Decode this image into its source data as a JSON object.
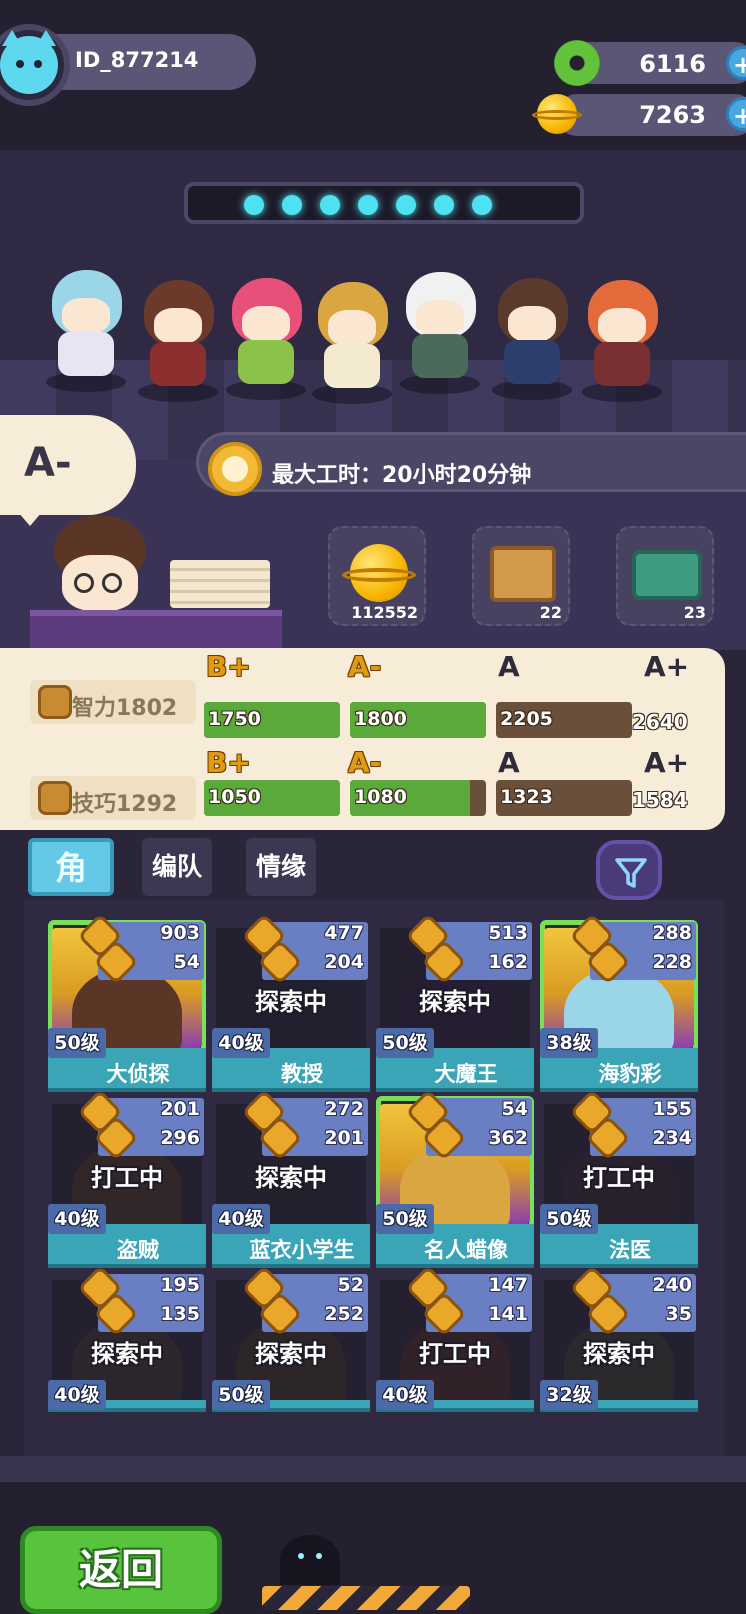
{
  "player": {
    "id": "ID_877214"
  },
  "currencies": {
    "donut": "6116",
    "gold": "7263",
    "plus_label": "+"
  },
  "scene": {
    "grade_bubble": "A-",
    "worktime_label": "最大工时：20小时20分钟",
    "resources": [
      {
        "icon": "gold-planet-icon",
        "count": "112552"
      },
      {
        "icon": "crate-icon",
        "count": "22"
      },
      {
        "icon": "bone-kit-icon",
        "count": "23"
      }
    ]
  },
  "stats": {
    "rows": [
      {
        "name": "智力1802",
        "grades": [
          "B+",
          "A-",
          "A",
          "A+"
        ],
        "thresholds": [
          "1750",
          "1800",
          "2205",
          "2640"
        ],
        "fills": [
          1,
          1,
          0,
          0
        ]
      },
      {
        "name": "技巧1292",
        "grades": [
          "B+",
          "A-",
          "A",
          "A+"
        ],
        "thresholds": [
          "1050",
          "1080",
          "1323",
          "1584"
        ],
        "fills": [
          1,
          0.88,
          0,
          0
        ]
      }
    ]
  },
  "tabs": {
    "characters": "角色",
    "team": "编队",
    "bond": "情缘"
  },
  "cards": [
    {
      "v1": "903",
      "v2": "54",
      "status": "",
      "level": "50级",
      "name": "大侦探"
    },
    {
      "v1": "477",
      "v2": "204",
      "status": "探索中",
      "level": "40级",
      "name": "教授"
    },
    {
      "v1": "513",
      "v2": "162",
      "status": "探索中",
      "level": "50级",
      "name": "大魔王"
    },
    {
      "v1": "288",
      "v2": "228",
      "status": "",
      "level": "38级",
      "name": "海豹彩"
    },
    {
      "v1": "201",
      "v2": "296",
      "status": "打工中",
      "level": "40级",
      "name": "盗贼"
    },
    {
      "v1": "272",
      "v2": "201",
      "status": "探索中",
      "level": "40级",
      "name": "蓝衣小学生"
    },
    {
      "v1": "54",
      "v2": "362",
      "status": "",
      "level": "50级",
      "name": "名人蜡像"
    },
    {
      "v1": "155",
      "v2": "234",
      "status": "打工中",
      "level": "50级",
      "name": "法医"
    },
    {
      "v1": "195",
      "v2": "135",
      "status": "探索中",
      "level": "40级",
      "name": ""
    },
    {
      "v1": "52",
      "v2": "252",
      "status": "探索中",
      "level": "50级",
      "name": ""
    },
    {
      "v1": "147",
      "v2": "141",
      "status": "打工中",
      "level": "40级",
      "name": ""
    },
    {
      "v1": "240",
      "v2": "35",
      "status": "探索中",
      "level": "32级",
      "name": ""
    }
  ],
  "footer": {
    "back_label": "返回"
  },
  "colors": {
    "accent_blue": "#63c9e6",
    "back_green": "#58c43d",
    "bar_green": "#5ba83b",
    "bar_brown": "#6a4f3b"
  }
}
